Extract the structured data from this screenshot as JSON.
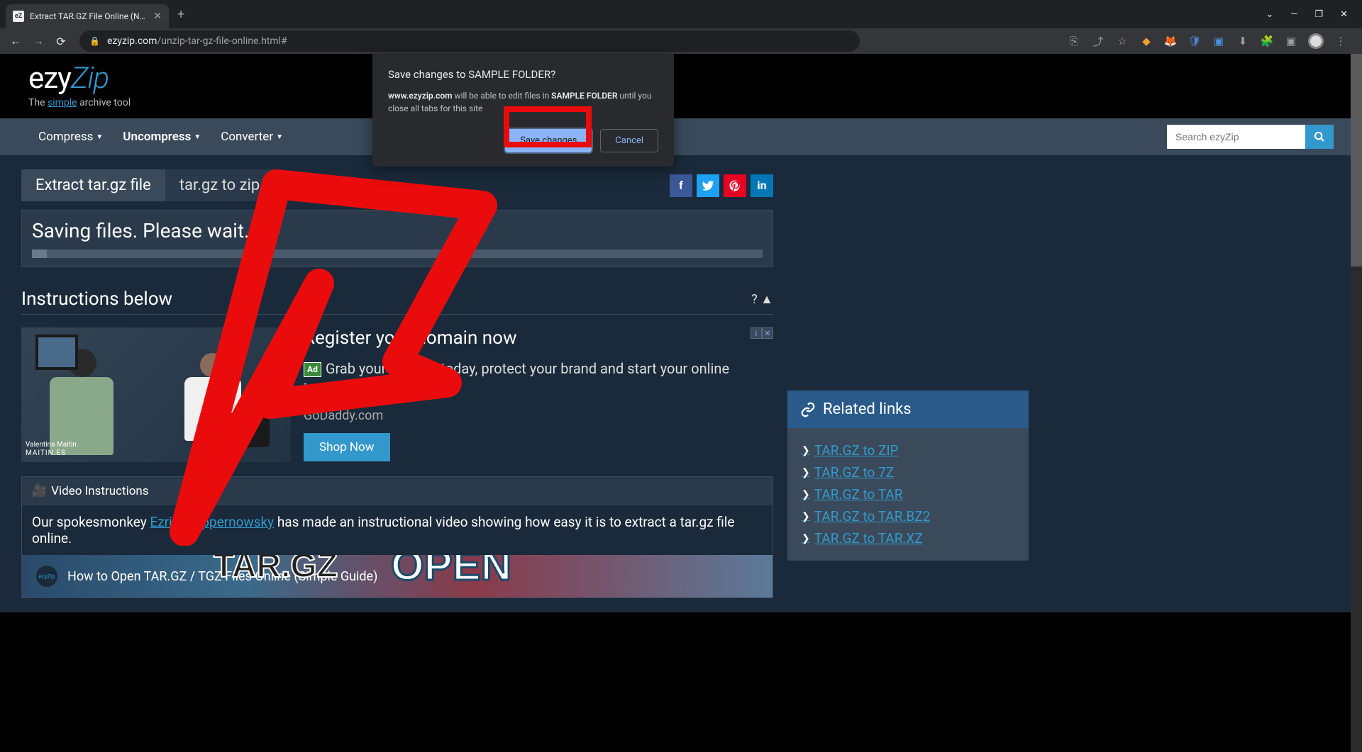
{
  "browser": {
    "tab_title": "Extract TAR.GZ File Online (No lim",
    "url_host": "ezyzip.com",
    "url_path": "/unzip-tar-gz-file-online.html#"
  },
  "logo": {
    "part1": "ezy",
    "part2": "Zip",
    "tagline_pre": "The ",
    "tagline_simple": "simple",
    "tagline_post": " archive tool"
  },
  "nav": {
    "compress": "Compress",
    "uncompress": "Uncompress",
    "converter": "Converter",
    "search_placeholder": "Search ezyZip"
  },
  "tabs": {
    "extract": "Extract tar.gz file",
    "to_zip": "tar.gz to zip"
  },
  "saving": {
    "text": "Saving files. Please wait..."
  },
  "instructions": {
    "title": "Instructions below",
    "help": "? ▲"
  },
  "ad": {
    "title": "Register your domain now",
    "badge": "Ad",
    "desc": "Grab your domain today, protect your brand and start your online journey with GoDaddy",
    "source": "GoDaddy.com",
    "button": "Shop Now",
    "x": "✕",
    "i": "i",
    "img_name": "Valentina Maitin",
    "img_sub": "MAITIN.ES"
  },
  "video": {
    "header": "Video Instructions",
    "desc_pre": "Our spokesmonkey ",
    "author": "Ezriah Zippernowsky",
    "desc_post": " has made an instructional video showing how easy it is to extract a tar.gz file online.",
    "thumb_title": "How to Open TAR.GZ / TGZ Files Online (Simple Guide)",
    "thumb_logo": "ezyZip"
  },
  "related": {
    "title": "Related links",
    "items": [
      "TAR.GZ to ZIP",
      "TAR.GZ to 7Z",
      "TAR.GZ to TAR",
      "TAR.GZ to TAR.BZ2",
      "TAR.GZ to TAR.XZ"
    ]
  },
  "dialog": {
    "title": "Save changes to SAMPLE FOLDER?",
    "host": "www.ezyzip.com",
    "body_mid": " will be able to edit files in ",
    "folder": "SAMPLE FOLDER",
    "body_post": " until you close all tabs for this site",
    "save": "Save changes",
    "cancel": "Cancel"
  },
  "colors": {
    "accent": "#3399cc",
    "red": "#ea0c0c"
  }
}
